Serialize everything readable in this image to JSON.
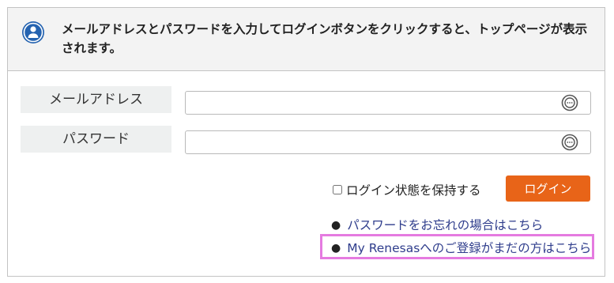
{
  "info": {
    "icon": "user-circle-icon",
    "message": "メールアドレスとパスワードを入力してログインボタンをクリックすると、トップページが表示されます。"
  },
  "form": {
    "email_label": "メールアドレス",
    "email_value": "",
    "password_label": "パスワード",
    "password_value": "",
    "field_badge_icon": "more-options-icon",
    "remember_label": "ログイン状態を保持する",
    "remember_checked": false,
    "login_button": "ログイン"
  },
  "links": {
    "forgot_password": "パスワードをお忘れの場合はこちら",
    "register": "My Renesasへのご登録がまだの方はこちら"
  },
  "colors": {
    "login_button": "#e86418",
    "link": "#2f3d8c",
    "icon_blue": "#2563b0",
    "highlight": "#e57be0"
  }
}
